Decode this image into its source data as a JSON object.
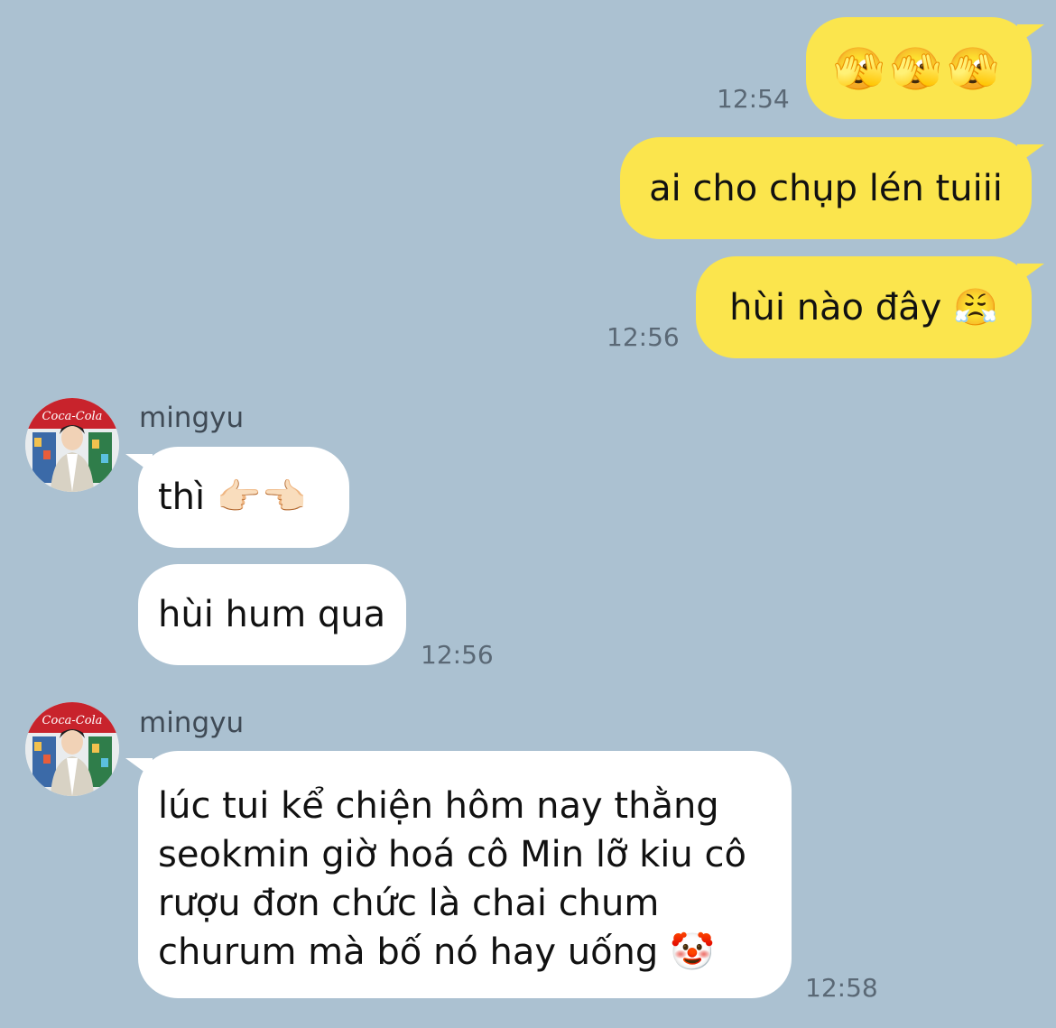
{
  "chat": {
    "messages_out": [
      {
        "text": "🫣🫣🫣",
        "time": "12:54"
      },
      {
        "text": "ai cho chụp lén tuiii",
        "time": ""
      },
      {
        "text": "hùi nào đây 😤",
        "time": "12:56"
      }
    ],
    "group1": {
      "sender": "mingyu",
      "messages": [
        {
          "text": "thì 👉🏻👈🏻"
        },
        {
          "text": "hùi hum qua"
        }
      ],
      "time": "12:56"
    },
    "group2": {
      "sender": "mingyu",
      "lines": [
        "lúc tui kể chiện hôm nay thằng",
        "seokmin giờ hoá cô Min lỡ kiu cô",
        "rượu đơn chức là chai chum",
        "churum mà bố nó hay uống 🤡"
      ],
      "time": "12:58"
    }
  },
  "avatar": {
    "icon": "person-photo-icon",
    "sign_text": "Coca-Cola"
  },
  "colors": {
    "background": "#abc1d1",
    "outgoing_bubble": "#fbe54d",
    "incoming_bubble": "#ffffff",
    "time_text": "#5a6875"
  }
}
